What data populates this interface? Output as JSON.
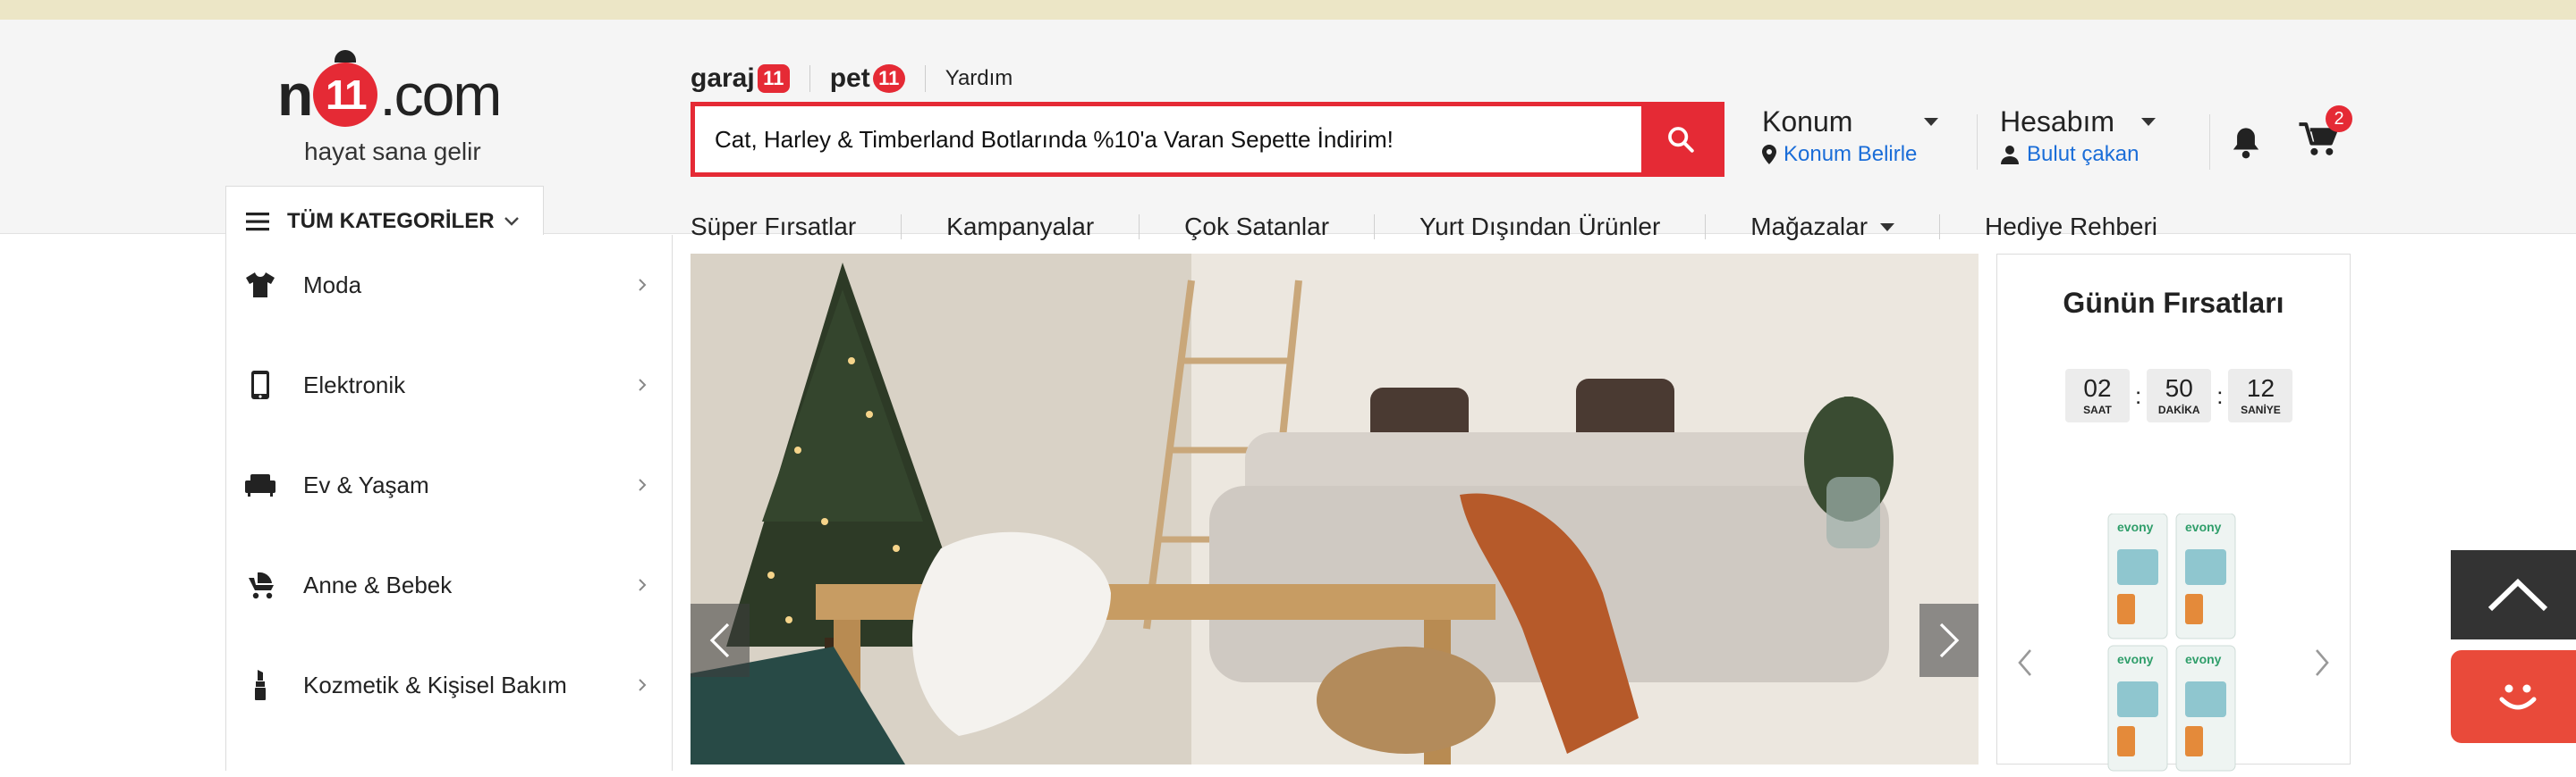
{
  "logo": {
    "prefix": "n",
    "eleven": "11",
    "suffix": ".com",
    "slogan": "hayat sana gelir"
  },
  "toplinks": {
    "garaj": "garaj",
    "garaj_badge": "11",
    "pet": "pet",
    "pet_badge": "11",
    "help": "Yardım"
  },
  "search": {
    "value": "Cat, Harley & Timberland Botlarında %10'a Varan Sepette İndirim!"
  },
  "location": {
    "title": "Konum",
    "subtitle": "Konum Belirle"
  },
  "account": {
    "title": "Hesabım",
    "subtitle": "Bulut çakan"
  },
  "cart": {
    "count": "2"
  },
  "all_categories": "TÜM KATEGORİLER",
  "nav": [
    {
      "label": "Süper Fırsatlar"
    },
    {
      "label": "Kampanyalar"
    },
    {
      "label": "Çok Satanlar"
    },
    {
      "label": "Yurt Dışından Ürünler"
    },
    {
      "label": "Mağazalar"
    },
    {
      "label": "Hediye Rehberi"
    }
  ],
  "categories": [
    {
      "label": "Moda",
      "icon": "tshirt-icon"
    },
    {
      "label": "Elektronik",
      "icon": "phone-icon"
    },
    {
      "label": "Ev & Yaşam",
      "icon": "sofa-icon"
    },
    {
      "label": "Anne & Bebek",
      "icon": "stroller-icon"
    },
    {
      "label": "Kozmetik & Kişisel Bakım",
      "icon": "lipstick-icon"
    }
  ],
  "deals": {
    "title": "Günün Fırsatları",
    "timer": {
      "hours": "02",
      "hours_label": "SAAT",
      "minutes": "50",
      "minutes_label": "DAKİKA",
      "seconds": "12",
      "seconds_label": "SANİYE"
    },
    "product_brand": "evony"
  },
  "colors": {
    "brand_red": "#e52a35",
    "link_blue": "#1a6dd8",
    "chat_red": "#e94a3a"
  }
}
